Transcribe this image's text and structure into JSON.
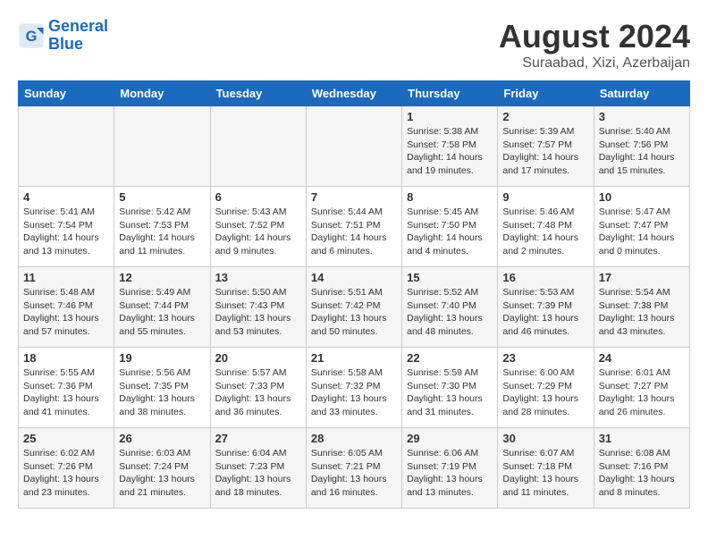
{
  "header": {
    "logo_line1": "General",
    "logo_line2": "Blue",
    "month_year": "August 2024",
    "location": "Suraabad, Xizi, Azerbaijan"
  },
  "weekdays": [
    "Sunday",
    "Monday",
    "Tuesday",
    "Wednesday",
    "Thursday",
    "Friday",
    "Saturday"
  ],
  "weeks": [
    [
      {
        "day": "",
        "text": ""
      },
      {
        "day": "",
        "text": ""
      },
      {
        "day": "",
        "text": ""
      },
      {
        "day": "",
        "text": ""
      },
      {
        "day": "1",
        "text": "Sunrise: 5:38 AM\nSunset: 7:58 PM\nDaylight: 14 hours\nand 19 minutes."
      },
      {
        "day": "2",
        "text": "Sunrise: 5:39 AM\nSunset: 7:57 PM\nDaylight: 14 hours\nand 17 minutes."
      },
      {
        "day": "3",
        "text": "Sunrise: 5:40 AM\nSunset: 7:56 PM\nDaylight: 14 hours\nand 15 minutes."
      }
    ],
    [
      {
        "day": "4",
        "text": "Sunrise: 5:41 AM\nSunset: 7:54 PM\nDaylight: 14 hours\nand 13 minutes."
      },
      {
        "day": "5",
        "text": "Sunrise: 5:42 AM\nSunset: 7:53 PM\nDaylight: 14 hours\nand 11 minutes."
      },
      {
        "day": "6",
        "text": "Sunrise: 5:43 AM\nSunset: 7:52 PM\nDaylight: 14 hours\nand 9 minutes."
      },
      {
        "day": "7",
        "text": "Sunrise: 5:44 AM\nSunset: 7:51 PM\nDaylight: 14 hours\nand 6 minutes."
      },
      {
        "day": "8",
        "text": "Sunrise: 5:45 AM\nSunset: 7:50 PM\nDaylight: 14 hours\nand 4 minutes."
      },
      {
        "day": "9",
        "text": "Sunrise: 5:46 AM\nSunset: 7:48 PM\nDaylight: 14 hours\nand 2 minutes."
      },
      {
        "day": "10",
        "text": "Sunrise: 5:47 AM\nSunset: 7:47 PM\nDaylight: 14 hours\nand 0 minutes."
      }
    ],
    [
      {
        "day": "11",
        "text": "Sunrise: 5:48 AM\nSunset: 7:46 PM\nDaylight: 13 hours\nand 57 minutes."
      },
      {
        "day": "12",
        "text": "Sunrise: 5:49 AM\nSunset: 7:44 PM\nDaylight: 13 hours\nand 55 minutes."
      },
      {
        "day": "13",
        "text": "Sunrise: 5:50 AM\nSunset: 7:43 PM\nDaylight: 13 hours\nand 53 minutes."
      },
      {
        "day": "14",
        "text": "Sunrise: 5:51 AM\nSunset: 7:42 PM\nDaylight: 13 hours\nand 50 minutes."
      },
      {
        "day": "15",
        "text": "Sunrise: 5:52 AM\nSunset: 7:40 PM\nDaylight: 13 hours\nand 48 minutes."
      },
      {
        "day": "16",
        "text": "Sunrise: 5:53 AM\nSunset: 7:39 PM\nDaylight: 13 hours\nand 46 minutes."
      },
      {
        "day": "17",
        "text": "Sunrise: 5:54 AM\nSunset: 7:38 PM\nDaylight: 13 hours\nand 43 minutes."
      }
    ],
    [
      {
        "day": "18",
        "text": "Sunrise: 5:55 AM\nSunset: 7:36 PM\nDaylight: 13 hours\nand 41 minutes."
      },
      {
        "day": "19",
        "text": "Sunrise: 5:56 AM\nSunset: 7:35 PM\nDaylight: 13 hours\nand 38 minutes."
      },
      {
        "day": "20",
        "text": "Sunrise: 5:57 AM\nSunset: 7:33 PM\nDaylight: 13 hours\nand 36 minutes."
      },
      {
        "day": "21",
        "text": "Sunrise: 5:58 AM\nSunset: 7:32 PM\nDaylight: 13 hours\nand 33 minutes."
      },
      {
        "day": "22",
        "text": "Sunrise: 5:59 AM\nSunset: 7:30 PM\nDaylight: 13 hours\nand 31 minutes."
      },
      {
        "day": "23",
        "text": "Sunrise: 6:00 AM\nSunset: 7:29 PM\nDaylight: 13 hours\nand 28 minutes."
      },
      {
        "day": "24",
        "text": "Sunrise: 6:01 AM\nSunset: 7:27 PM\nDaylight: 13 hours\nand 26 minutes."
      }
    ],
    [
      {
        "day": "25",
        "text": "Sunrise: 6:02 AM\nSunset: 7:26 PM\nDaylight: 13 hours\nand 23 minutes."
      },
      {
        "day": "26",
        "text": "Sunrise: 6:03 AM\nSunset: 7:24 PM\nDaylight: 13 hours\nand 21 minutes."
      },
      {
        "day": "27",
        "text": "Sunrise: 6:04 AM\nSunset: 7:23 PM\nDaylight: 13 hours\nand 18 minutes."
      },
      {
        "day": "28",
        "text": "Sunrise: 6:05 AM\nSunset: 7:21 PM\nDaylight: 13 hours\nand 16 minutes."
      },
      {
        "day": "29",
        "text": "Sunrise: 6:06 AM\nSunset: 7:19 PM\nDaylight: 13 hours\nand 13 minutes."
      },
      {
        "day": "30",
        "text": "Sunrise: 6:07 AM\nSunset: 7:18 PM\nDaylight: 13 hours\nand 11 minutes."
      },
      {
        "day": "31",
        "text": "Sunrise: 6:08 AM\nSunset: 7:16 PM\nDaylight: 13 hours\nand 8 minutes."
      }
    ]
  ]
}
